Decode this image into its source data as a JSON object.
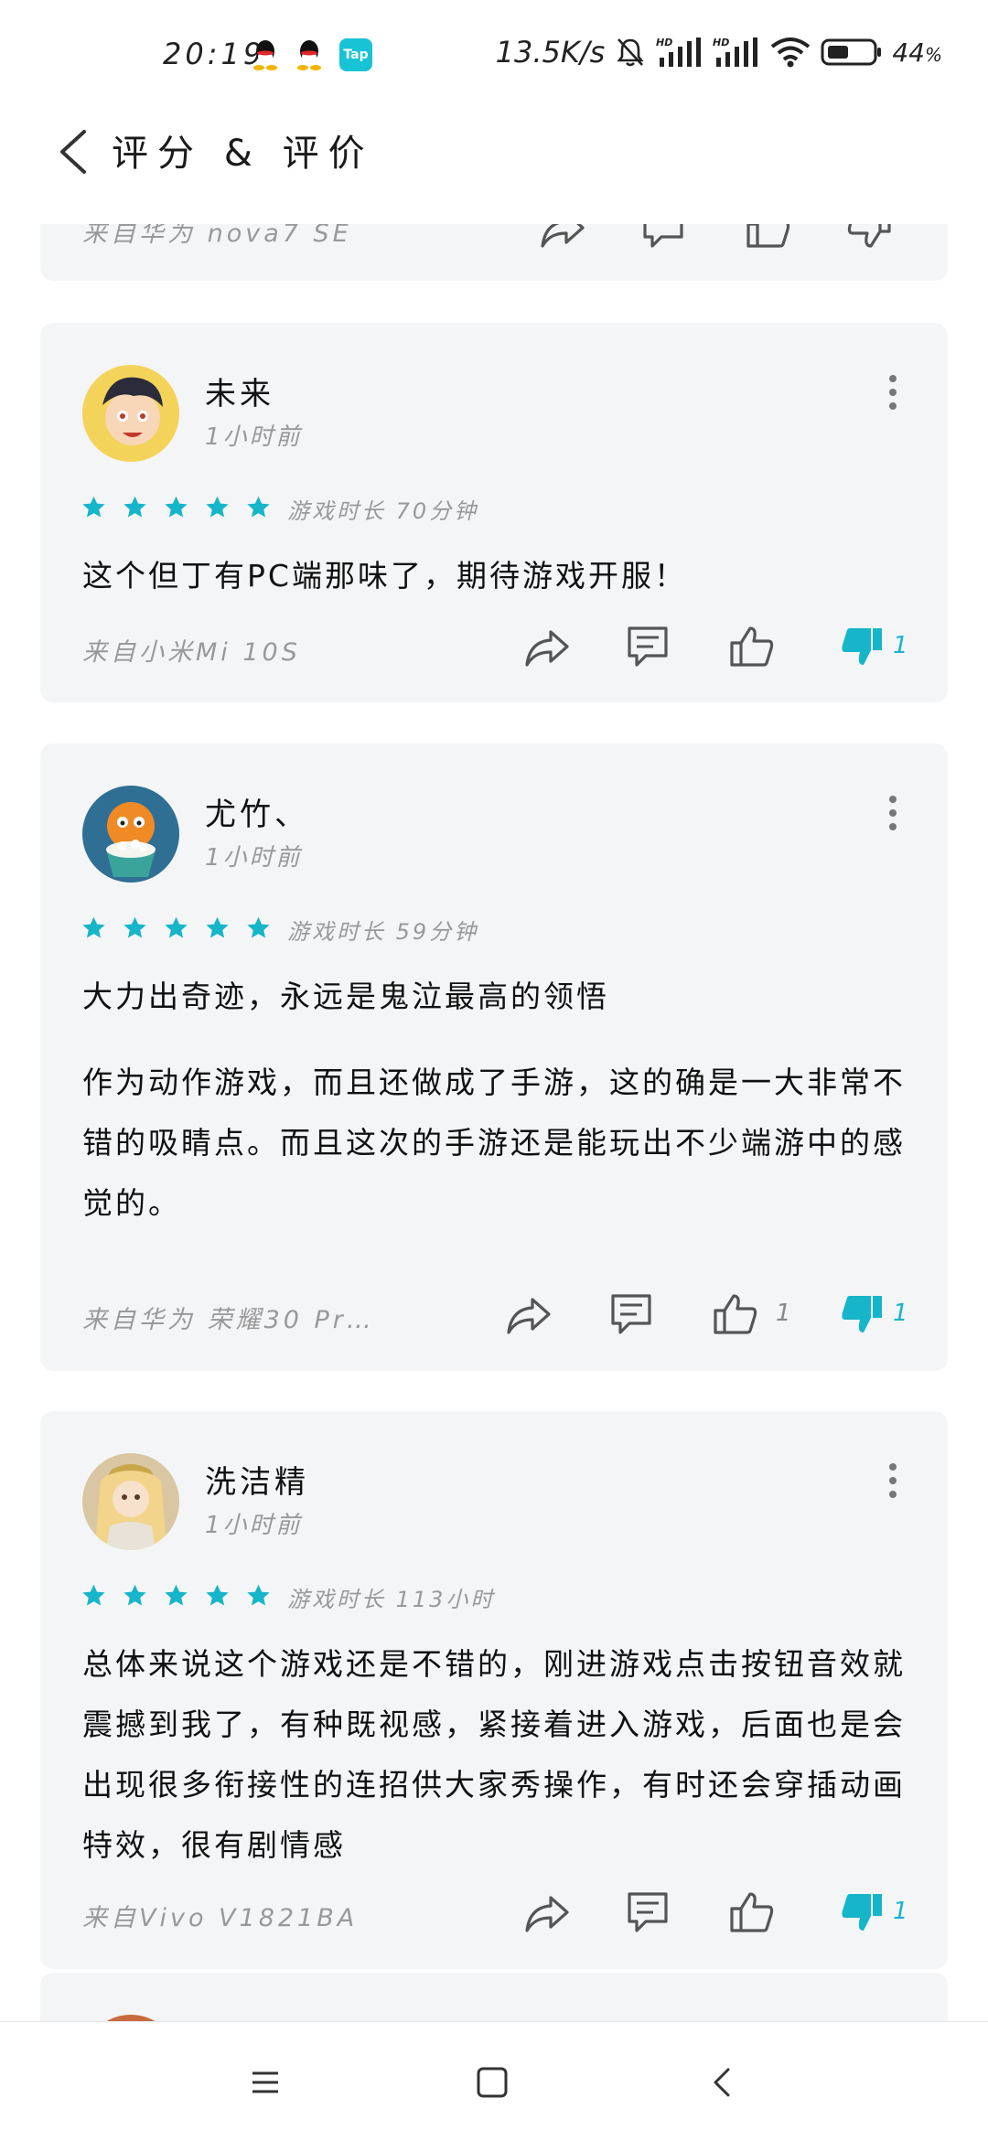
{
  "status_bar": {
    "time": "20:19",
    "network_speed": "13.5K/s",
    "battery": "44",
    "battery_unit": "%",
    "tap_label": "Tap"
  },
  "header": {
    "title": "评分 & 评价"
  },
  "partial_top_card": {
    "device": "来自华为 nova7 SE"
  },
  "reviews": [
    {
      "username": "未来",
      "time": "1小时前",
      "stars": 5,
      "playtime": "游戏时长 70分钟",
      "paragraphs": [
        "这个但丁有PC端那味了，期待游戏开服！"
      ],
      "device": "来自小米Mi 10S",
      "like_count": "",
      "dislike_count": "1"
    },
    {
      "username": "尤竹、",
      "time": "1小时前",
      "stars": 5,
      "playtime": "游戏时长 59分钟",
      "paragraphs": [
        "大力出奇迹，永远是鬼泣最高的领悟",
        "作为动作游戏，而且还做成了手游，这的确是一大非常不错的吸睛点。而且这次的手游还是能玩出不少端游中的感觉的。"
      ],
      "device": "来自华为 荣耀30 Pr…",
      "like_count": "1",
      "dislike_count": "1"
    },
    {
      "username": "洗洁精",
      "time": "1小时前",
      "stars": 5,
      "playtime": "游戏时长 113小时",
      "paragraphs": [
        "总体来说这个游戏还是不错的，刚进游戏点击按钮音效就震撼到我了，有种既视感，紧接着进入游戏，后面也是会出现很多衔接性的连招供大家秀操作，有时还会穿插动画特效，很有剧情感"
      ],
      "device": "来自Vivo V1821BA",
      "like_count": "",
      "dislike_count": "1"
    }
  ],
  "colors": {
    "accent": "#16b5c9",
    "card_bg": "#f4f5f7",
    "muted_text": "#999999"
  },
  "icons": {
    "back": "chevron-left-icon",
    "more": "more-vertical-icon",
    "share": "share-icon",
    "comment": "comment-icon",
    "like": "thumbs-up-icon",
    "dislike": "thumbs-down-icon",
    "star": "star-icon"
  },
  "nav": {
    "items": [
      "menu",
      "home",
      "back"
    ]
  }
}
